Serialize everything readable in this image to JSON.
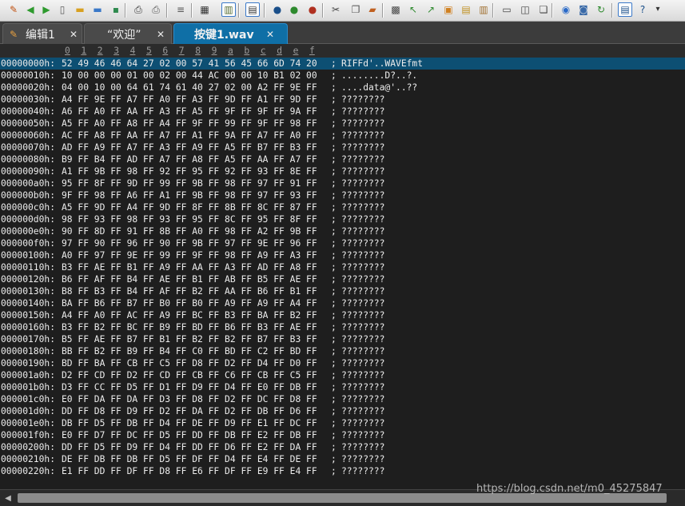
{
  "toolbar": {
    "icons": [
      {
        "name": "editor-app-icon",
        "glyph": "✎",
        "color": "#c05010"
      },
      {
        "name": "back-arrow-icon",
        "glyph": "◀",
        "color": "#2e9a2e"
      },
      {
        "name": "forward-arrow-icon",
        "glyph": "▶",
        "color": "#2e9a2e"
      },
      {
        "name": "new-file-icon",
        "glyph": "▯",
        "color": "#5a5a5a"
      },
      {
        "name": "open-folder-icon",
        "glyph": "▬",
        "color": "#d8a020"
      },
      {
        "name": "open-folder-2-icon",
        "glyph": "▬",
        "color": "#3a78c8"
      },
      {
        "name": "save-icon",
        "glyph": "▪",
        "color": "#2e8a4e"
      },
      {
        "name": "print-icon",
        "glyph": "⎙",
        "color": "#333333"
      },
      {
        "name": "print-preview-icon",
        "glyph": "⎙",
        "color": "#555555"
      },
      {
        "name": "page-icon",
        "glyph": "≡",
        "color": "#555555"
      },
      {
        "name": "hex-mode-icon",
        "glyph": "▦",
        "color": "#333333"
      },
      {
        "name": "column-mode-icon",
        "glyph": "▥",
        "color": "#556b2f"
      },
      {
        "name": "text-mode-icon",
        "glyph": "▤",
        "color": "#333333"
      },
      {
        "name": "uc-case-icon",
        "glyph": "●",
        "color": "#1a4f8a"
      },
      {
        "name": "green-case-icon",
        "glyph": "●",
        "color": "#2e8a2e"
      },
      {
        "name": "red-case-icon",
        "glyph": "●",
        "color": "#b03020"
      },
      {
        "name": "cut-icon",
        "glyph": "✂",
        "color": "#444444"
      },
      {
        "name": "copy-icon",
        "glyph": "❐",
        "color": "#555555"
      },
      {
        "name": "paste-icon",
        "glyph": "▰",
        "color": "#c06020"
      },
      {
        "name": "find-icon",
        "glyph": "▩",
        "color": "#444444"
      },
      {
        "name": "find-prev-icon",
        "glyph": "↖",
        "color": "#2e8a2e"
      },
      {
        "name": "find-next-icon",
        "glyph": "↗",
        "color": "#2e8a2e"
      },
      {
        "name": "bookmark-icon",
        "glyph": "▣",
        "color": "#d08020"
      },
      {
        "name": "mark-icon",
        "glyph": "▤",
        "color": "#c09020"
      },
      {
        "name": "notes-icon",
        "glyph": "▥",
        "color": "#a07030"
      },
      {
        "name": "window-icon",
        "glyph": "▭",
        "color": "#444444"
      },
      {
        "name": "split-window-icon",
        "glyph": "◫",
        "color": "#444444"
      },
      {
        "name": "cascade-window-icon",
        "glyph": "❏",
        "color": "#444444"
      },
      {
        "name": "browser-globe-icon",
        "glyph": "◉",
        "color": "#2a6ac8"
      },
      {
        "name": "screenshot-icon",
        "glyph": "◙",
        "color": "#3a6aa8"
      },
      {
        "name": "refresh-icon",
        "glyph": "↻",
        "color": "#2e8a2e"
      },
      {
        "name": "panel-icon",
        "glyph": "▤",
        "color": "#1a4f8a"
      },
      {
        "name": "help-icon",
        "glyph": "?",
        "color": "#1a4f8a"
      },
      {
        "name": "toolbar-overflow-icon",
        "glyph": "▾",
        "color": "#333333"
      }
    ]
  },
  "tabs": [
    {
      "label": "编辑1",
      "close": "✕",
      "icon": "✎",
      "active": false
    },
    {
      "label": "“欢迎”",
      "close": "✕",
      "icon": "",
      "active": false
    },
    {
      "label": "按键1.wav",
      "close": "✕",
      "icon": "",
      "active": true
    }
  ],
  "ruler": {
    "columns": [
      "0",
      "1",
      "2",
      "3",
      "4",
      "5",
      "6",
      "7",
      "8",
      "9",
      "a",
      "b",
      "c",
      "d",
      "e",
      "f"
    ]
  },
  "hex": {
    "rows": [
      {
        "addr": "00000000h:",
        "bytes": "52 49 46 46 64 27 02 00 57 41 56 45 66 6D 74 20",
        "ascii": "RIFFd'..WAVEfmt"
      },
      {
        "addr": "00000010h:",
        "bytes": "10 00 00 00 01 00 02 00 44 AC 00 00 10 B1 02 00",
        "ascii": "........D?..?."
      },
      {
        "addr": "00000020h:",
        "bytes": "04 00 10 00 64 61 74 61 40 27 02 00 A2 FF 9E FF",
        "ascii": "....data@'..??"
      },
      {
        "addr": "00000030h:",
        "bytes": "A4 FF 9E FF A7 FF A0 FF A3 FF 9D FF A1 FF 9D FF",
        "ascii": "????????"
      },
      {
        "addr": "00000040h:",
        "bytes": "A6 FF A0 FF AA FF A3 FF A5 FF 9F FF 9F FF 9A FF",
        "ascii": "????????"
      },
      {
        "addr": "00000050h:",
        "bytes": "A5 FF A0 FF A8 FF A4 FF 9F FF 99 FF 9F FF 98 FF",
        "ascii": "????????"
      },
      {
        "addr": "00000060h:",
        "bytes": "AC FF A8 FF AA FF A7 FF A1 FF 9A FF A7 FF A0 FF",
        "ascii": "????????"
      },
      {
        "addr": "00000070h:",
        "bytes": "AD FF A9 FF A7 FF A3 FF A9 FF A5 FF B7 FF B3 FF",
        "ascii": "????????"
      },
      {
        "addr": "00000080h:",
        "bytes": "B9 FF B4 FF AD FF A7 FF A8 FF A5 FF AA FF A7 FF",
        "ascii": "????????"
      },
      {
        "addr": "00000090h:",
        "bytes": "A1 FF 9B FF 98 FF 92 FF 95 FF 92 FF 93 FF 8E FF",
        "ascii": "????????"
      },
      {
        "addr": "000000a0h:",
        "bytes": "95 FF 8F FF 9D FF 99 FF 9B FF 98 FF 97 FF 91 FF",
        "ascii": "????????"
      },
      {
        "addr": "000000b0h:",
        "bytes": "9F FF 98 FF A6 FF A1 FF 9B FF 98 FF 97 FF 93 FF",
        "ascii": "????????"
      },
      {
        "addr": "000000c0h:",
        "bytes": "A5 FF 9D FF A4 FF 9D FF 8F FF 8B FF 8C FF 87 FF",
        "ascii": "????????"
      },
      {
        "addr": "000000d0h:",
        "bytes": "98 FF 93 FF 98 FF 93 FF 95 FF 8C FF 95 FF 8F FF",
        "ascii": "????????"
      },
      {
        "addr": "000000e0h:",
        "bytes": "90 FF 8D FF 91 FF 8B FF A0 FF 98 FF A2 FF 9B FF",
        "ascii": "????????"
      },
      {
        "addr": "000000f0h:",
        "bytes": "97 FF 90 FF 96 FF 90 FF 9B FF 97 FF 9E FF 96 FF",
        "ascii": "????????"
      },
      {
        "addr": "00000100h:",
        "bytes": "A0 FF 97 FF 9E FF 99 FF 9F FF 98 FF A9 FF A3 FF",
        "ascii": "????????"
      },
      {
        "addr": "00000110h:",
        "bytes": "B3 FF AE FF B1 FF A9 FF AA FF A3 FF AD FF A8 FF",
        "ascii": "????????"
      },
      {
        "addr": "00000120h:",
        "bytes": "B6 FF AF FF B4 FF AE FF B1 FF AB FF B5 FF AE FF",
        "ascii": "????????"
      },
      {
        "addr": "00000130h:",
        "bytes": "B8 FF B3 FF B4 FF AF FF B2 FF AA FF B6 FF B1 FF",
        "ascii": "????????"
      },
      {
        "addr": "00000140h:",
        "bytes": "BA FF B6 FF B7 FF B0 FF B0 FF A9 FF A9 FF A4 FF",
        "ascii": "????????"
      },
      {
        "addr": "00000150h:",
        "bytes": "A4 FF A0 FF AC FF A9 FF BC FF B3 FF BA FF B2 FF",
        "ascii": "????????"
      },
      {
        "addr": "00000160h:",
        "bytes": "B3 FF B2 FF BC FF B9 FF BD FF B6 FF B3 FF AE FF",
        "ascii": "????????"
      },
      {
        "addr": "00000170h:",
        "bytes": "B5 FF AE FF B7 FF B1 FF B2 FF B2 FF B7 FF B3 FF",
        "ascii": "????????"
      },
      {
        "addr": "00000180h:",
        "bytes": "BB FF B2 FF B9 FF B4 FF C0 FF BD FF C2 FF BD FF",
        "ascii": "????????"
      },
      {
        "addr": "00000190h:",
        "bytes": "BD FF BA FF CB FF C5 FF D8 FF D2 FF D4 FF D0 FF",
        "ascii": "????????"
      },
      {
        "addr": "000001a0h:",
        "bytes": "D2 FF CD FF D2 FF CD FF CB FF C6 FF CB FF C5 FF",
        "ascii": "????????"
      },
      {
        "addr": "000001b0h:",
        "bytes": "D3 FF CC FF D5 FF D1 FF D9 FF D4 FF E0 FF DB FF",
        "ascii": "????????"
      },
      {
        "addr": "000001c0h:",
        "bytes": "E0 FF DA FF DA FF D3 FF D8 FF D2 FF DC FF D8 FF",
        "ascii": "????????"
      },
      {
        "addr": "000001d0h:",
        "bytes": "DD FF D8 FF D9 FF D2 FF DA FF D2 FF DB FF D6 FF",
        "ascii": "????????"
      },
      {
        "addr": "000001e0h:",
        "bytes": "DB FF D5 FF DB FF D4 FF DE FF D9 FF E1 FF DC FF",
        "ascii": "????????"
      },
      {
        "addr": "000001f0h:",
        "bytes": "E0 FF D7 FF DC FF D5 FF DD FF DB FF E2 FF DB FF",
        "ascii": "????????"
      },
      {
        "addr": "00000200h:",
        "bytes": "DD FF D5 FF D9 FF D4 FF DD FF D6 FF E2 FF DA FF",
        "ascii": "????????"
      },
      {
        "addr": "00000210h:",
        "bytes": "DE FF DB FF DB FF D5 FF DF FF D4 FF E4 FF DE FF",
        "ascii": "????????"
      },
      {
        "addr": "00000220h:",
        "bytes": "E1 FF DD FF DF FF D8 FF E6 FF DF FF E9 FF E4 FF",
        "ascii": "????????"
      }
    ]
  },
  "scrollbar": {
    "left_arrow": "◀"
  },
  "watermark": {
    "text": "https://blog.csdn.net/m0_45275847"
  }
}
